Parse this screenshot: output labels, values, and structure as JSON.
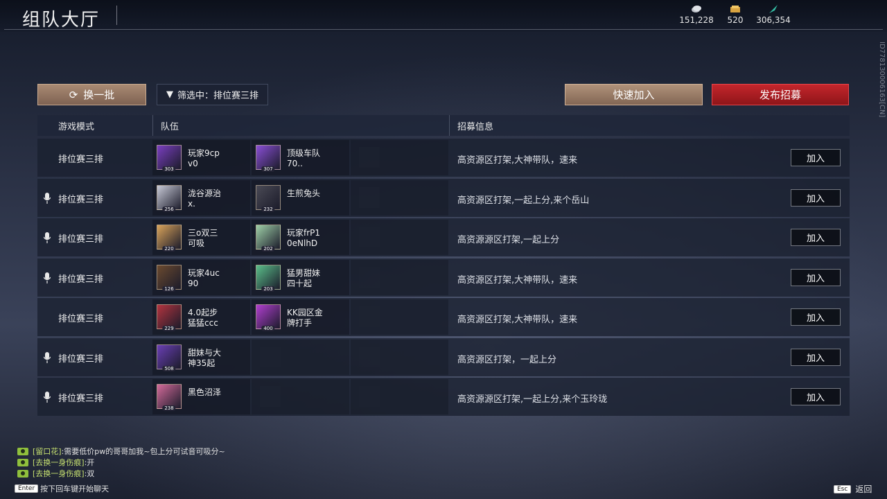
{
  "header": {
    "title": "组队大厅",
    "currencies": [
      {
        "icon": "silver-coin-icon",
        "value": "151,228"
      },
      {
        "icon": "gold-ticket-icon",
        "value": "520"
      },
      {
        "icon": "feather-token-icon",
        "value": "306,354"
      }
    ],
    "side_id": "ID778130006163[CN]"
  },
  "toolbar": {
    "refresh_label": "换一批",
    "filter_label": "筛选中：排位赛三排",
    "quick_join_label": "快速加入",
    "publish_label": "发布招募"
  },
  "table": {
    "headers": {
      "mode": "游戏模式",
      "team": "队伍",
      "info": "招募信息"
    },
    "join_label": "加入",
    "rows": [
      {
        "voice": false,
        "mode": "排位赛三排",
        "info": "高资源区打架,大神带队，速来",
        "members": [
          {
            "name": "玩家9cp\nv0",
            "level": "303",
            "color": "#7a3fc0"
          },
          {
            "name": "顶级车队\n70..",
            "level": "307",
            "color": "#8a4fd6"
          }
        ]
      },
      {
        "voice": true,
        "mode": "排位赛三排",
        "info": "高资源区打架,一起上分,来个岳山",
        "members": [
          {
            "name": "泷谷源治\nx.",
            "level": "256",
            "color": "#c7c9d6"
          },
          {
            "name": "生煎兔头",
            "level": "232",
            "color": "#4a4a55"
          }
        ]
      },
      {
        "voice": true,
        "mode": "排位赛三排",
        "info": "高资源源区打架,一起上分",
        "members": [
          {
            "name": "三o双三\n可吸",
            "level": "220",
            "color": "#d9a35a"
          },
          {
            "name": "玩家frP1\n0eNlhD",
            "level": "202",
            "color": "#9fd0a8"
          }
        ]
      },
      {
        "voice": true,
        "mode": "排位赛三排",
        "info": "高资源区打架,大神带队，速来",
        "members": [
          {
            "name": "玩家4uc\n90",
            "level": "126",
            "color": "#6b4a2f"
          },
          {
            "name": "猛男甜妹\n四十起",
            "level": "203",
            "color": "#5bbf8a"
          }
        ]
      },
      {
        "voice": false,
        "mode": "排位赛三排",
        "info": "高资源区打架,大神带队，速来",
        "members": [
          {
            "name": "4.0起步\n猛猛ccc",
            "level": "229",
            "color": "#b3343f"
          },
          {
            "name": "KK园区金\n牌打手",
            "level": "400",
            "color": "#b13fd0"
          }
        ]
      },
      {
        "voice": true,
        "mode": "排位赛三排",
        "info": "高资源区打架，一起上分",
        "members": [
          {
            "name": "甜妹与大\n神35起",
            "level": "508",
            "color": "#6a3fb5"
          }
        ]
      },
      {
        "voice": true,
        "mode": "排位赛三排",
        "info": "高资源源区打架,一起上分,来个玉玲珑",
        "members": [
          {
            "name": "黑色沼泽",
            "level": "238",
            "color": "#d36a9a"
          }
        ]
      }
    ]
  },
  "chat": [
    {
      "tag": "[留口花]",
      "text": ":需要低价pw的哥哥加我~包上分可试音可吸分~"
    },
    {
      "tag": "[去换一身伤痕]",
      "text": ":开"
    },
    {
      "tag": "[去换一身伤痕]",
      "text": ":双"
    }
  ],
  "footer": {
    "enter_key": "Enter",
    "enter_hint": "按下回车键开始聊天",
    "esc_key": "Esc",
    "back_label": "返回"
  },
  "colors": {
    "accent_gold": "#a98a73",
    "accent_red": "#c4262c",
    "chat_tag": "#c6e070"
  }
}
